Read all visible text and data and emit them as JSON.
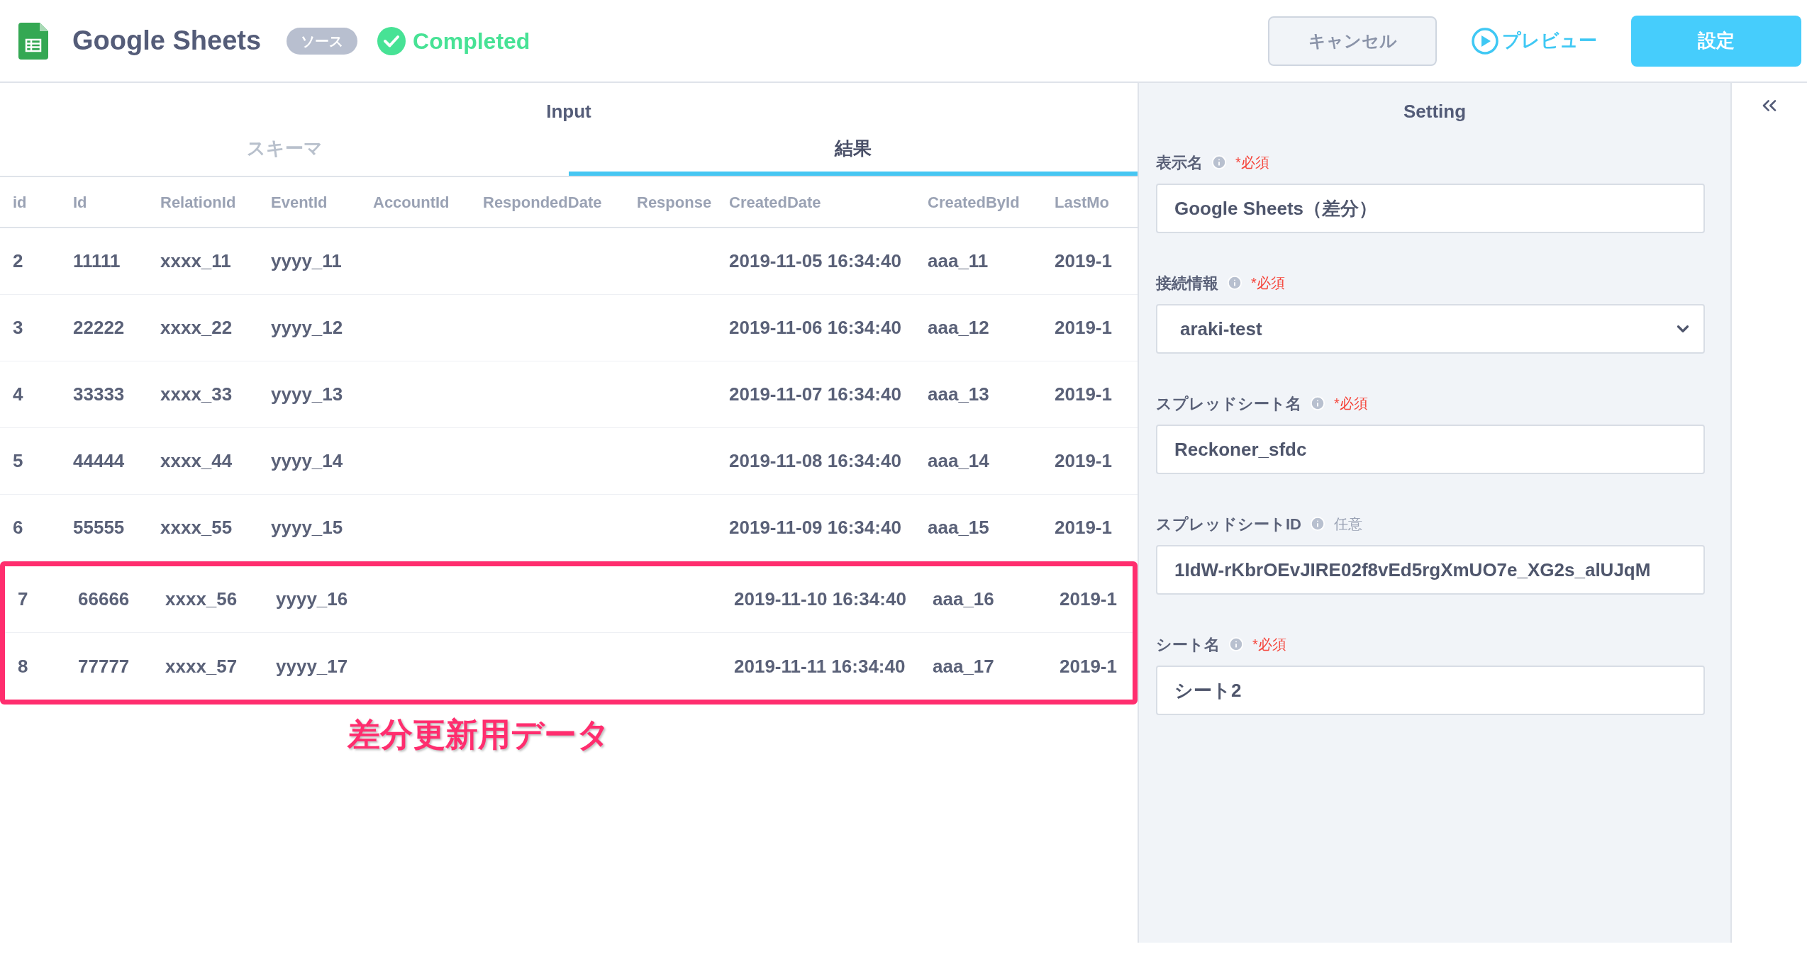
{
  "header": {
    "title": "Google Sheets",
    "badge": "ソース",
    "status": "Completed",
    "buttons": [
      {
        "kind": "secondary",
        "label": "キャンセル"
      },
      {
        "kind": "link",
        "label": "プレビュー"
      },
      {
        "kind": "primary",
        "label": "設定"
      }
    ]
  },
  "input_panel": {
    "title": "Input",
    "tabs": [
      {
        "label": "スキーマ",
        "selected": false
      },
      {
        "label": "結果",
        "selected": true
      }
    ],
    "table": {
      "columns": [
        "id",
        "Id",
        "RelationId",
        "EventId",
        "AccountId",
        "RespondedDate",
        "Response",
        "CreatedDate",
        "CreatedById",
        "LastMo"
      ],
      "rows": [
        {
          "highlighted": false,
          "cells": [
            "2",
            "11111",
            "xxxx_11",
            "yyyy_11",
            "",
            "",
            "",
            "2019-11-05 16:34:40",
            "aaa_11",
            "2019-1"
          ]
        },
        {
          "highlighted": false,
          "cells": [
            "3",
            "22222",
            "xxxx_22",
            "yyyy_12",
            "",
            "",
            "",
            "2019-11-06 16:34:40",
            "aaa_12",
            "2019-1"
          ]
        },
        {
          "highlighted": false,
          "cells": [
            "4",
            "33333",
            "xxxx_33",
            "yyyy_13",
            "",
            "",
            "",
            "2019-11-07 16:34:40",
            "aaa_13",
            "2019-1"
          ]
        },
        {
          "highlighted": false,
          "cells": [
            "5",
            "44444",
            "xxxx_44",
            "yyyy_14",
            "",
            "",
            "",
            "2019-11-08 16:34:40",
            "aaa_14",
            "2019-1"
          ]
        },
        {
          "highlighted": false,
          "cells": [
            "6",
            "55555",
            "xxxx_55",
            "yyyy_15",
            "",
            "",
            "",
            "2019-11-09 16:34:40",
            "aaa_15",
            "2019-1"
          ]
        },
        {
          "highlighted": true,
          "cells": [
            "7",
            "66666",
            "xxxx_56",
            "yyyy_16",
            "",
            "",
            "",
            "2019-11-10 16:34:40",
            "aaa_16",
            "2019-1"
          ]
        },
        {
          "highlighted": true,
          "cells": [
            "8",
            "77777",
            "xxxx_57",
            "yyyy_17",
            "",
            "",
            "",
            "2019-11-11 16:34:40",
            "aaa_17",
            "2019-1"
          ]
        }
      ]
    },
    "annotation": "差分更新用データ"
  },
  "setting_panel": {
    "title": "Setting",
    "fields": [
      {
        "label": "表示名",
        "required": true,
        "requirement": "*必須",
        "kind": "text",
        "value": "Google Sheets（差分）"
      },
      {
        "label": "接続情報",
        "required": true,
        "requirement": "*必須",
        "kind": "select",
        "value": "araki-test"
      },
      {
        "label": "スプレッドシート名",
        "required": true,
        "requirement": "*必須",
        "kind": "text",
        "value": "Reckoner_sfdc"
      },
      {
        "label": "スプレッドシートID",
        "required": false,
        "requirement": "任意",
        "kind": "text",
        "value": "1IdW-rKbrOEvJIRE02f8vEd5rgXmUO7e_XG2s_alUJqM"
      },
      {
        "label": "シート名",
        "required": true,
        "requirement": "*必須",
        "kind": "text",
        "value": "シート2"
      }
    ]
  }
}
